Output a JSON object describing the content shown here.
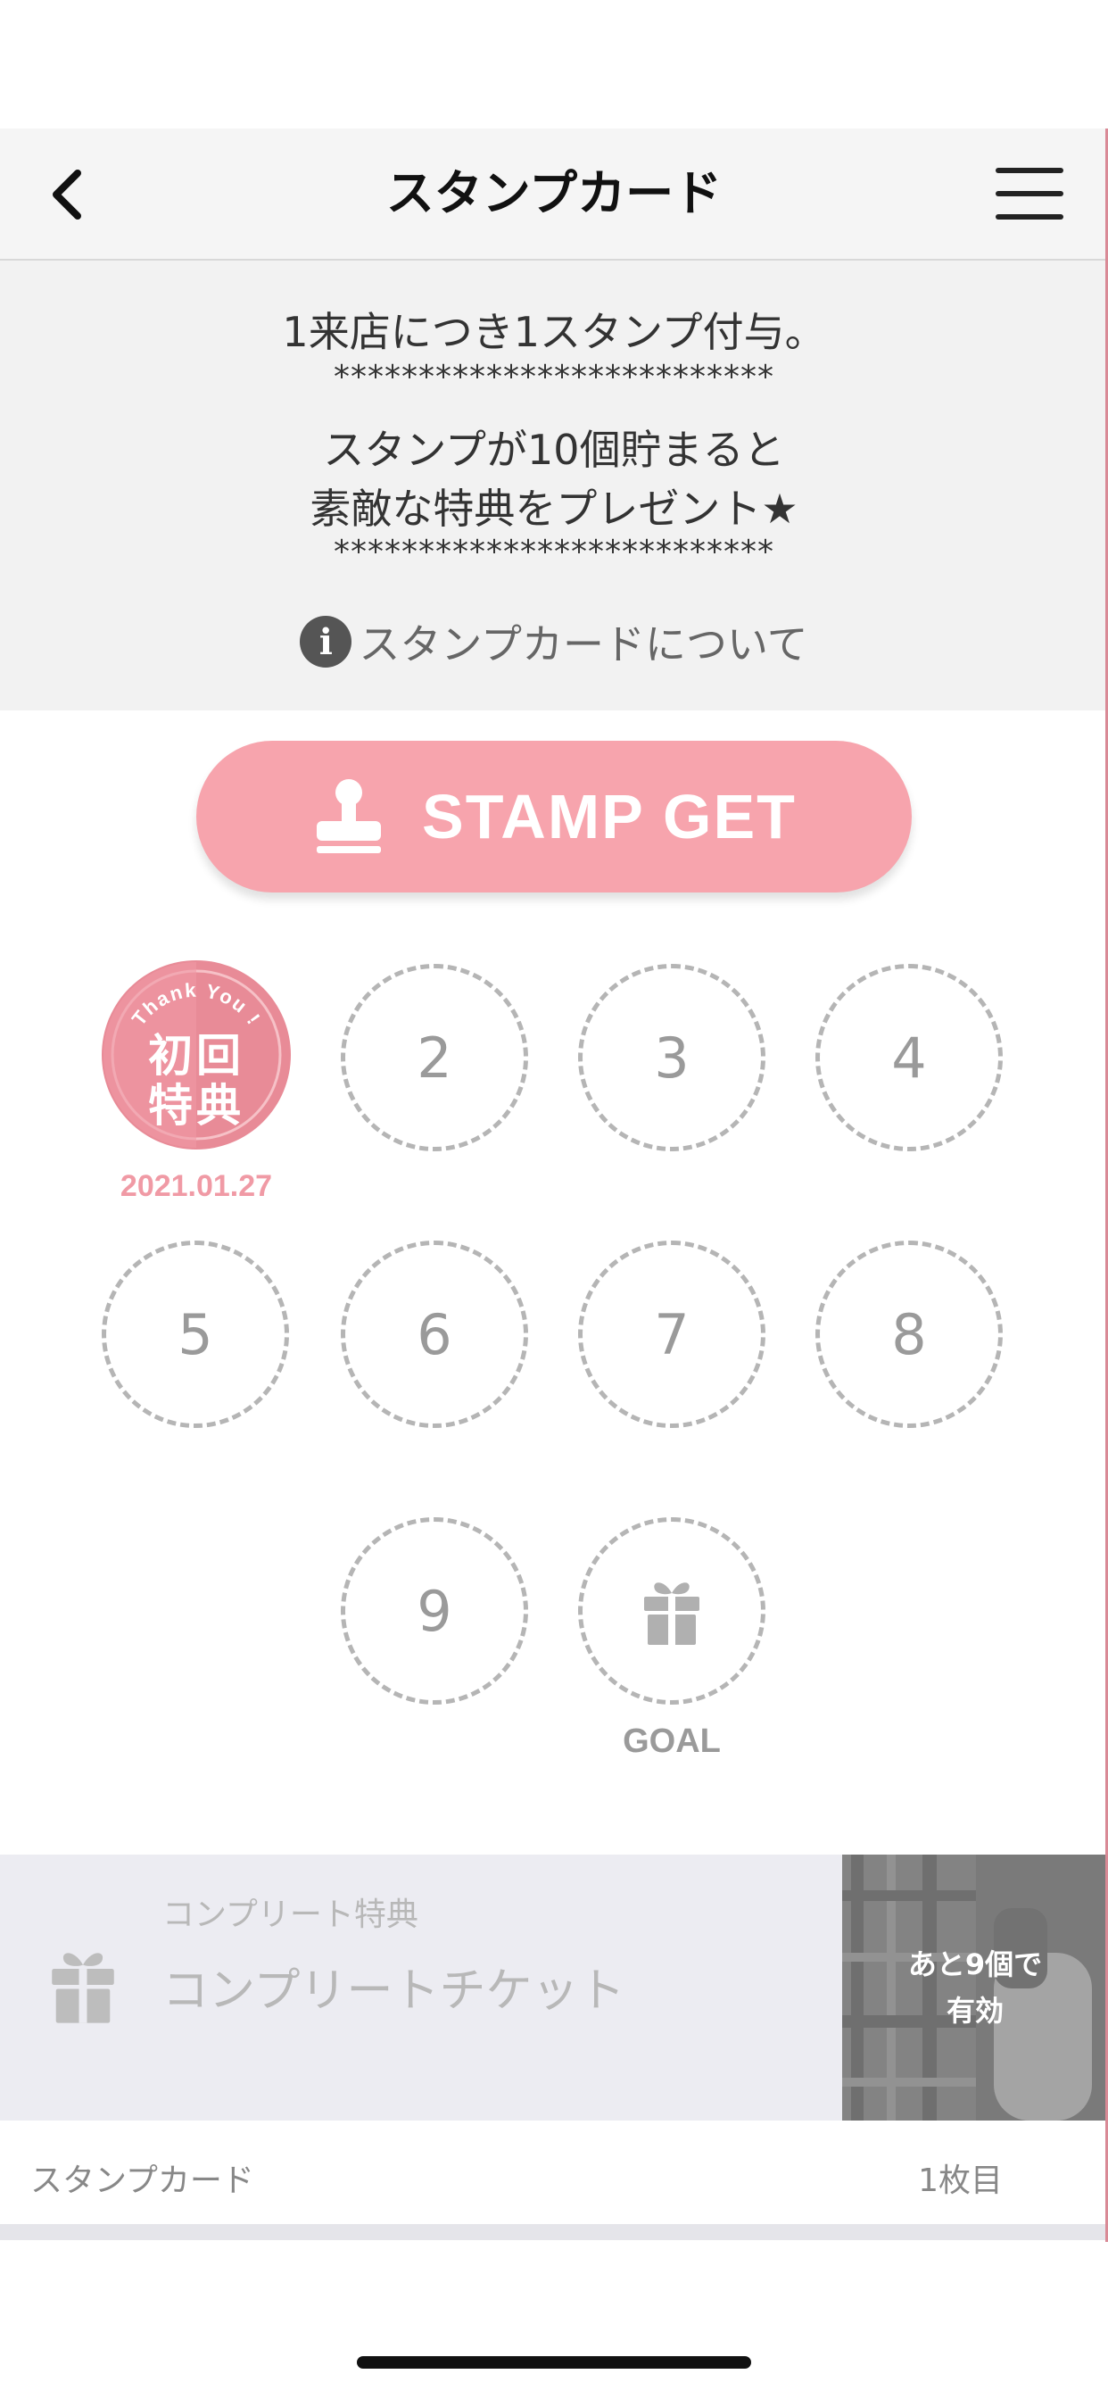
{
  "header": {
    "title": "スタンプカード"
  },
  "info": {
    "line1": "1来店につき1スタンプ付与。",
    "separator": "**************************",
    "line2": "スタンプが10個貯まると",
    "line3": "素敵な特典をプレゼント★",
    "about_link": "スタンプカードについて",
    "info_icon_glyph": "i"
  },
  "stamp_button": {
    "label": "STAMP GET",
    "color": "#f7a4ad"
  },
  "stamps": {
    "first": {
      "ribbon": "Thank You !",
      "line1": "初回",
      "line2": "特典",
      "date": "2021.01.27",
      "color": "#e88b97"
    },
    "slots": [
      "2",
      "3",
      "4",
      "5",
      "6",
      "7",
      "8",
      "9"
    ],
    "goal_label": "GOAL",
    "collected": 1,
    "total": 10
  },
  "complete": {
    "caption": "コンプリート特典",
    "title": "コンプリートチケット",
    "remaining_line1": "あと9個で",
    "remaining_line2": "有効"
  },
  "footer": {
    "label": "スタンプカード",
    "count": "1枚目"
  }
}
